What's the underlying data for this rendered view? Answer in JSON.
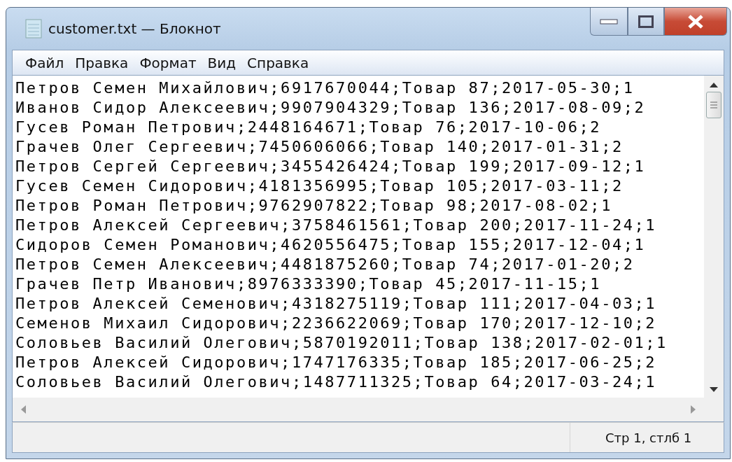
{
  "window": {
    "title": "customer.txt — Блокнот"
  },
  "menu": [
    "Файл",
    "Правка",
    "Формат",
    "Вид",
    "Справка"
  ],
  "lines": [
    "Петров Семен Михайлович;6917670044;Товар 87;2017-05-30;1",
    "Иванов Сидор Алексеевич;9907904329;Товар 136;2017-08-09;2",
    "Гусев Роман Петрович;2448164671;Товар 76;2017-10-06;2",
    "Грачев Олег Сергеевич;7450606066;Товар 140;2017-01-31;2",
    "Петров Сергей Сергеевич;3455426424;Товар 199;2017-09-12;1",
    "Гусев Семен Сидорович;4181356995;Товар 105;2017-03-11;2",
    "Петров Роман Петрович;9762907822;Товар 98;2017-08-02;1",
    "Петров Алексей Сергеевич;3758461561;Товар 200;2017-11-24;1",
    "Сидоров Семен Романович;4620556475;Товар 155;2017-12-04;1",
    "Петров Семен Алексеевич;4481875260;Товар 74;2017-01-20;2",
    "Грачев Петр Иванович;8976333390;Товар 45;2017-11-15;1",
    "Петров Алексей Семенович;4318275119;Товар 111;2017-04-03;1",
    "Семенов Михаил Сидорович;2236622069;Товар 170;2017-12-10;2",
    "Соловьев Василий Олегович;5870192011;Товар 138;2017-02-01;1",
    "Петров Алексей Сидорович;1747176335;Товар 185;2017-06-25;2",
    "Соловьев Василий Олегович;1487711325;Товар 64;2017-03-24;1"
  ],
  "status_bar": {
    "position": "Стр 1, стлб 1"
  }
}
